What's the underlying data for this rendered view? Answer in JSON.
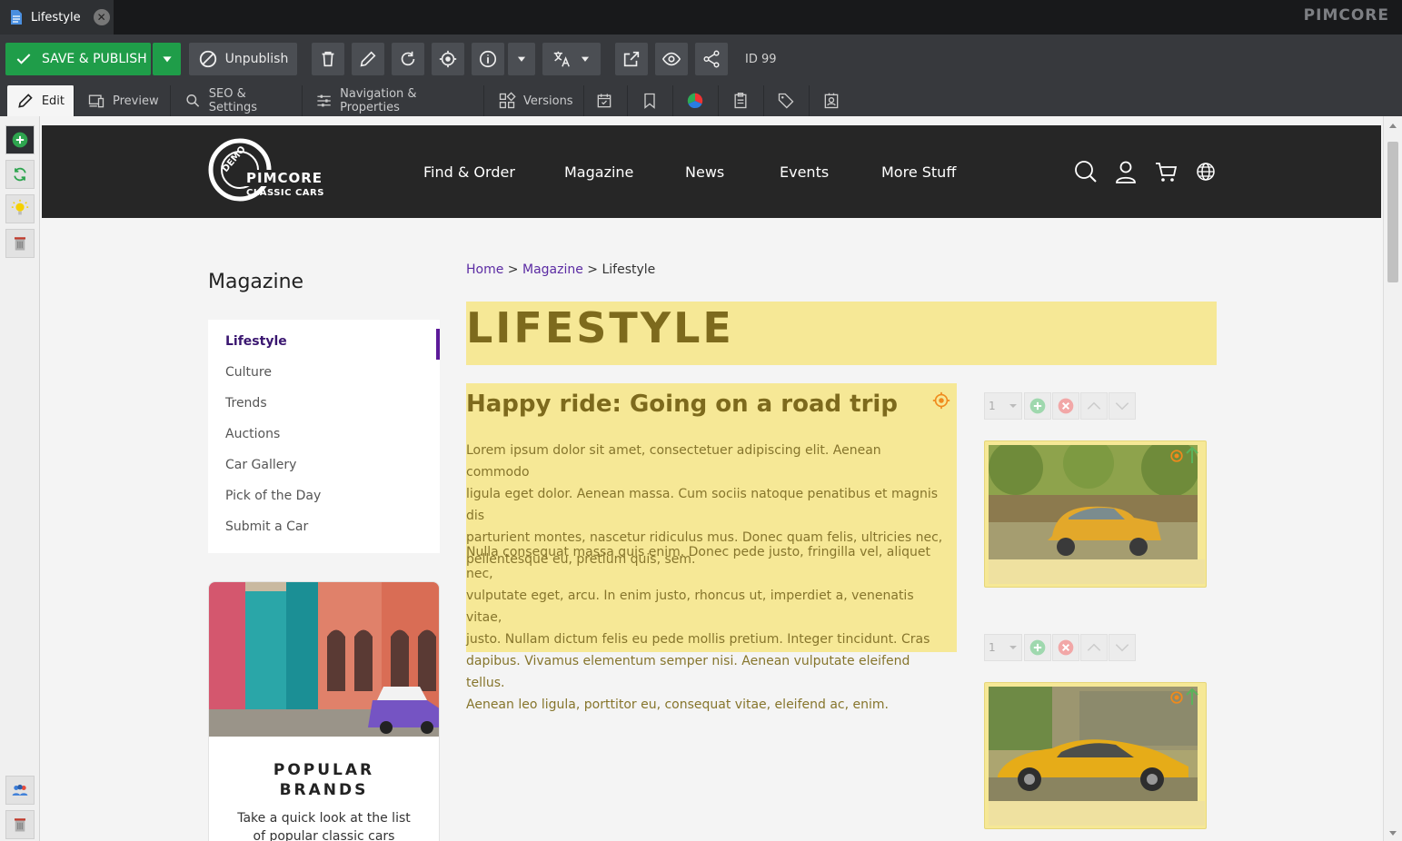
{
  "title_bar": {
    "tab_label": "Lifestyle",
    "brand": "PIMCORE"
  },
  "toolbar": {
    "save_publish_label": "SAVE & PUBLISH",
    "unpublish_label": "Unpublish",
    "id_label": "ID 99"
  },
  "subtabs": {
    "edit": "Edit",
    "preview": "Preview",
    "seo": "SEO & Settings",
    "navigation": "Navigation & Properties",
    "versions": "Versions"
  },
  "site": {
    "logo_top": "DEMO",
    "logo_main": "PIMCORE",
    "logo_sub": "CLASSIC CARS",
    "nav": [
      "Find & Order",
      "Magazine",
      "News",
      "Events",
      "More Stuff"
    ]
  },
  "sidebar": {
    "title": "Magazine",
    "items": [
      "Lifestyle",
      "Culture",
      "Trends",
      "Auctions",
      "Car Gallery",
      "Pick of the Day",
      "Submit a Car"
    ],
    "promo_title_line1": "POPULAR",
    "promo_title_line2": "BRANDS",
    "promo_text_line1": "Take a quick look at the list",
    "promo_text_line2": "of popular classic cars"
  },
  "breadcrumb": {
    "home": "Home",
    "sep1": " > ",
    "magazine": "Magazine",
    "sep2": " > ",
    "current": "Lifestyle"
  },
  "content": {
    "hero_title": "LIFESTYLE",
    "article_title": "Happy ride: Going on a road trip",
    "para1": [
      "Lorem ipsum dolor sit amet, consectetuer adipiscing elit. Aenean commodo",
      "ligula eget dolor. Aenean massa. Cum sociis natoque penatibus et magnis dis",
      "parturient montes, nascetur ridiculus mus. Donec quam felis, ultricies nec,",
      "pellentesque eu, pretium quis, sem."
    ],
    "para2": [
      "Nulla consequat massa quis enim. Donec pede justo, fringilla vel, aliquet nec,",
      "vulputate eget, arcu. In enim justo, rhoncus ut, imperdiet a, venenatis vitae,",
      "justo. Nullam dictum felis eu pede mollis pretium. Integer tincidunt. Cras",
      "dapibus. Vivamus elementum semper nisi. Aenean vulputate eleifend tellus.",
      "Aenean leo ligula, porttitor eu, consequat vitae, eleifend ac, enim."
    ],
    "block1_select": "1",
    "block2_select": "1"
  },
  "colors": {
    "accent_green": "#1f9d49",
    "editable_highlight": "#f6e896",
    "active_nav": "#5c1a99"
  }
}
